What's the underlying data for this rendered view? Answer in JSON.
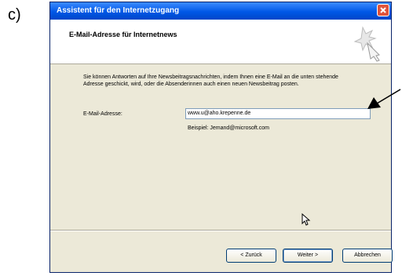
{
  "figure_label": "c)",
  "window": {
    "title": "Assistent für den Internetzugang",
    "header_title": "E-Mail-Adresse für Internetnews",
    "description": "Sie können Antworten auf Ihre Newsbeitragsnachrichten, indem Ihnen eine E-Mail an die unten stehende Adresse geschickt, wird, oder die Absenderinnen auch einen neuen Newsbeitrag posten.",
    "email_label": "E-Mail-Adresse:",
    "email_value": "www.u@aho.krepenne.de",
    "example": "Beispiel: Jemand@microsoft.com",
    "buttons": {
      "back": "< Zurück",
      "next": "Weiter >",
      "cancel": "Abbrechen"
    }
  },
  "colors": {
    "titlebar": "#0058e6",
    "dialog_bg": "#ece9d8",
    "close": "#e0533a"
  }
}
